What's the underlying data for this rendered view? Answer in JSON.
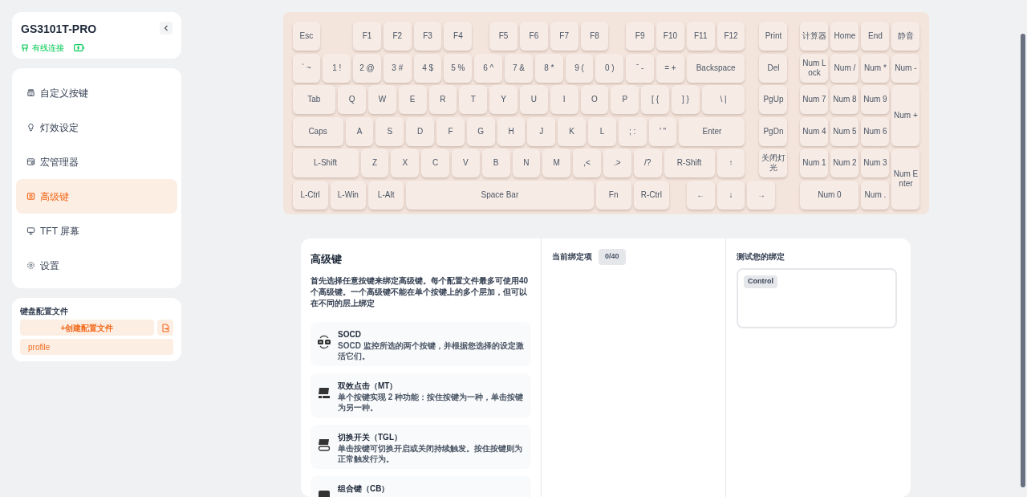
{
  "device": {
    "name": "GS3101T-PRO",
    "connection": "有线连接"
  },
  "nav": [
    {
      "label": "自定义按键",
      "selected": false
    },
    {
      "label": "灯效设定",
      "selected": false
    },
    {
      "label": "宏管理器",
      "selected": false
    },
    {
      "label": "高级键",
      "selected": true
    },
    {
      "label": "TFT 屏幕",
      "selected": false
    },
    {
      "label": "设置",
      "selected": false
    }
  ],
  "profiles": {
    "title": "键盘配置文件",
    "create_label": "+创建配置文件",
    "items": [
      {
        "label": "profile",
        "selected": true
      }
    ]
  },
  "keyboard": {
    "key_rows": [
      {
        "keys": [
          "Esc",
          "F1",
          "F2",
          "F3",
          "F4",
          "F5",
          "F6",
          "F7",
          "F8",
          "F9",
          "F10",
          "F11",
          "F12",
          "Print"
        ]
      },
      {
        "keys": [
          "` ~",
          "1 !",
          "2 @",
          "3 #",
          "4 $",
          "5 %",
          "6 ^",
          "7 &",
          "8 *",
          "9 (",
          "0 )",
          "ˉ -",
          "= +",
          "Backspace",
          "Del"
        ]
      },
      {
        "keys": [
          "Tab",
          "Q",
          "W",
          "E",
          "R",
          "T",
          "Y",
          "U",
          "I",
          "O",
          "P",
          "[ {",
          "] }",
          "\\ |",
          "PgUp"
        ]
      },
      {
        "keys": [
          "Caps",
          "A",
          "S",
          "D",
          "F",
          "G",
          "H",
          "J",
          "K",
          "L",
          "; :",
          "' \"",
          "Enter",
          "PgDn"
        ]
      },
      {
        "keys": [
          "L-Shift",
          "Z",
          "X",
          "C",
          "V",
          "B",
          "N",
          "M",
          ",<",
          ".>",
          "/?",
          "R-Shift",
          "↑",
          "关闭灯光"
        ]
      },
      {
        "keys": [
          "L-Ctrl",
          "L-Win",
          "L-Alt",
          "Space Bar",
          "Fn",
          "R-Ctrl",
          "←",
          "↓",
          "→"
        ]
      }
    ],
    "numpad": [
      "计算器",
      "Home",
      "End",
      "静音",
      "Num Lock",
      "Num /",
      "Num *",
      "Num -",
      "Num 7",
      "Num 8",
      "Num 9",
      "Num +",
      "Num 4",
      "Num 5",
      "Num 6",
      "Num 1",
      "Num 2",
      "Num 3",
      "Num Enter",
      "Num 0",
      "Num ."
    ]
  },
  "advanced": {
    "title": "高级键",
    "description": "首先选择任意按键来绑定高级键。每个配置文件最多可使用40个高级键。一个高级键不能在单个按键上的多个层加，但可以在不同的层上绑定",
    "features": [
      {
        "kind": "socd",
        "title": "SOCD",
        "description": "SOCD 监控所选的两个按键，并根据您选择的设定激活它们。"
      },
      {
        "kind": "mt",
        "title": "双效点击（MT）",
        "description": "单个按键实现 2 种功能：按住按键为一种，单击按键为另一种。"
      },
      {
        "kind": "tgl",
        "title": "切换开关（TGL）",
        "description": "单击按键可切换开启或关闭持续触发。按住按键则为正常触发行为。"
      },
      {
        "kind": "cb",
        "title": "组合键（CB）"
      }
    ]
  },
  "bindings": {
    "title": "当前绑定项",
    "count": "0/40"
  },
  "test": {
    "title": "测试您的绑定",
    "keys": [
      "Control"
    ]
  }
}
